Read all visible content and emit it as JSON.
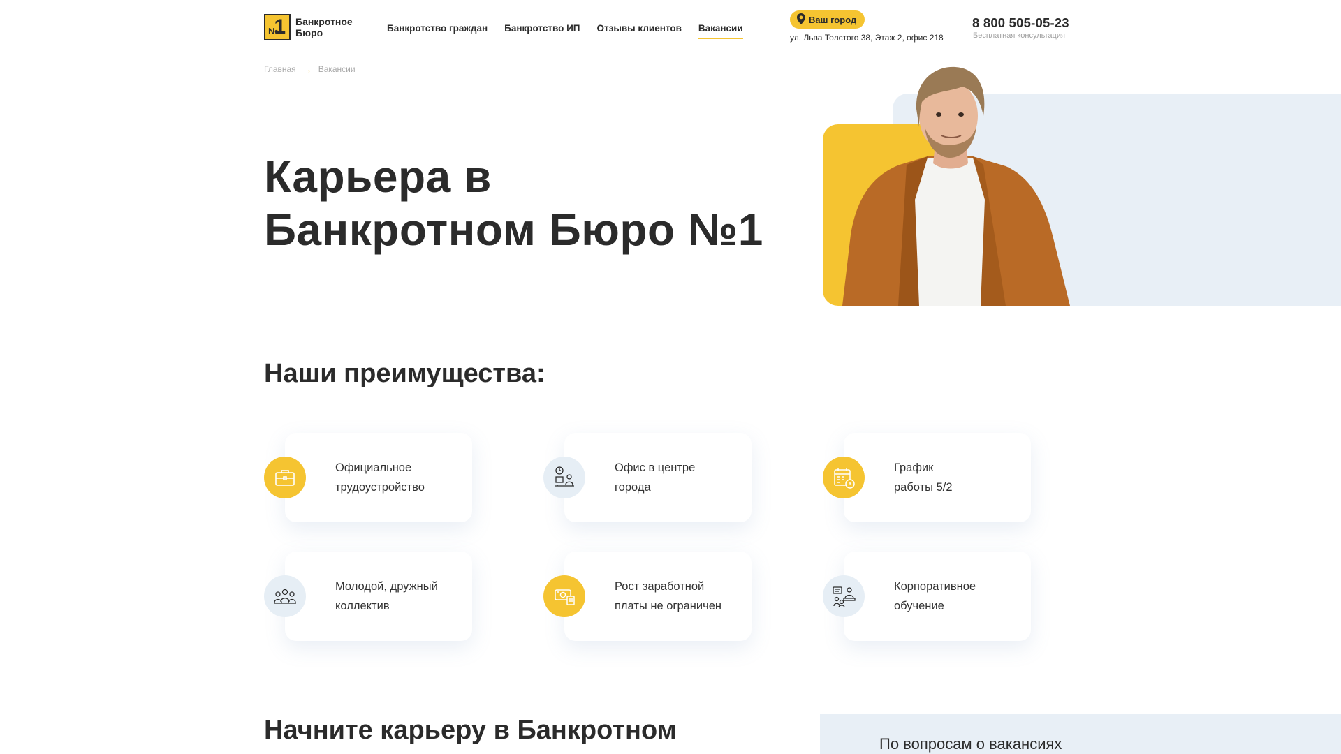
{
  "header": {
    "logo_line1": "Банкротное",
    "logo_line2": "Бюро",
    "logo_no": "№",
    "logo_one": "1",
    "nav": [
      {
        "label": "Банкротство граждан"
      },
      {
        "label": "Банкротство ИП"
      },
      {
        "label": "Отзывы клиентов"
      },
      {
        "label": "Вакансии"
      }
    ],
    "city_button": "Ваш город",
    "address": "ул. Льва Толстого 38, Этаж 2, офис 218",
    "phone": "8 800 505-05-23",
    "phone_caption": "Бесплатная консультация"
  },
  "breadcrumb": {
    "home": "Главная",
    "current": "Вакансии"
  },
  "hero": {
    "title_line1": "Карьера в",
    "title_line2": "Банкротном Бюро №1"
  },
  "advantages": {
    "title": "Наши преимущества:",
    "items": [
      {
        "line1": "Официальное",
        "line2": "трудоустройство",
        "icon": "briefcase-icon"
      },
      {
        "line1": "Офис в центре",
        "line2": "города",
        "icon": "office-icon"
      },
      {
        "line1": "График",
        "line2": "работы 5/2",
        "icon": "calendar-icon"
      },
      {
        "line1": "Молодой, дружный",
        "line2": "коллектив",
        "icon": "team-icon"
      },
      {
        "line1": "Рост заработной",
        "line2": "платы не ограничен",
        "icon": "money-icon"
      },
      {
        "line1": "Корпоративное",
        "line2": "обучение",
        "icon": "training-icon"
      }
    ]
  },
  "bottom": {
    "start_title": "Начните карьеру в Банкротном",
    "contact_text": "По вопросам о вакансиях"
  },
  "colors": {
    "accent": "#f5c431",
    "text": "#2b2b2b",
    "light_blue": "#e8eff6"
  }
}
